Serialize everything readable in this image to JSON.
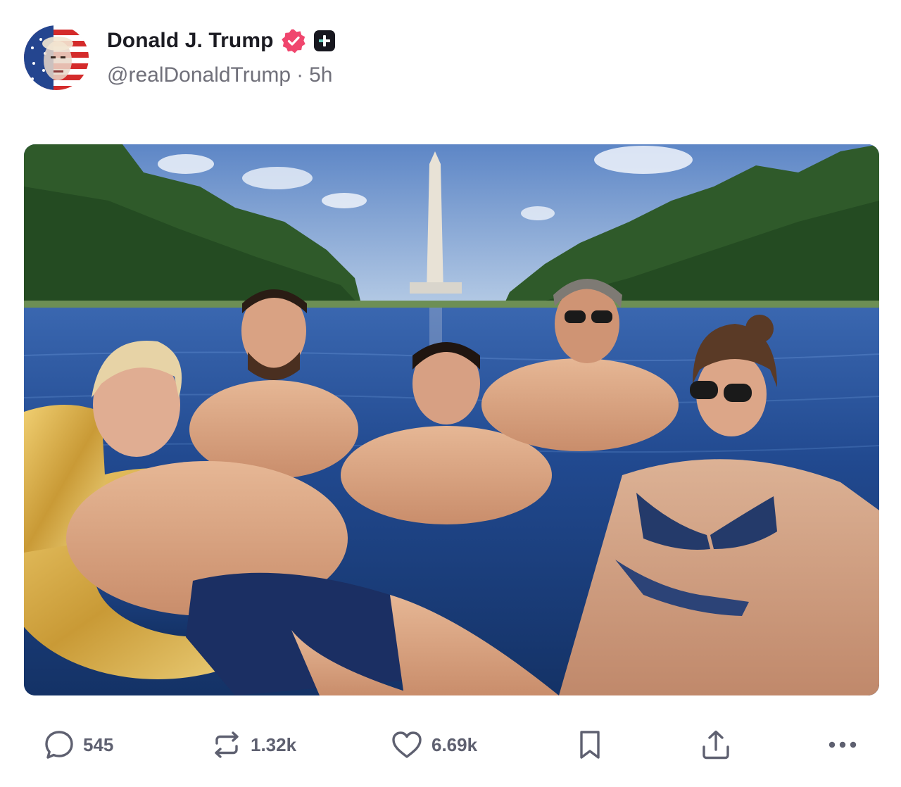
{
  "post": {
    "author": {
      "display_name": "Donald J. Trump",
      "handle": "@realDonaldTrump",
      "separator": "·",
      "time_ago": "5h",
      "verified_badge": "verified-badge-icon",
      "plus_badge": "plus-badge-icon"
    },
    "media": {
      "type": "image",
      "alt": ""
    },
    "actions": {
      "reply": {
        "icon": "reply-icon",
        "count": "545"
      },
      "repost": {
        "icon": "repost-icon",
        "count": "1.32k"
      },
      "like": {
        "icon": "heart-icon",
        "count": "6.69k"
      },
      "bookmark": {
        "icon": "bookmark-icon"
      },
      "share": {
        "icon": "share-icon"
      },
      "more": {
        "icon": "more-icon"
      }
    }
  },
  "colors": {
    "verified_badge": "#f0466e",
    "plus_badge": "#17171f",
    "action_icon": "#5e6070",
    "handle_text": "#70707a"
  }
}
